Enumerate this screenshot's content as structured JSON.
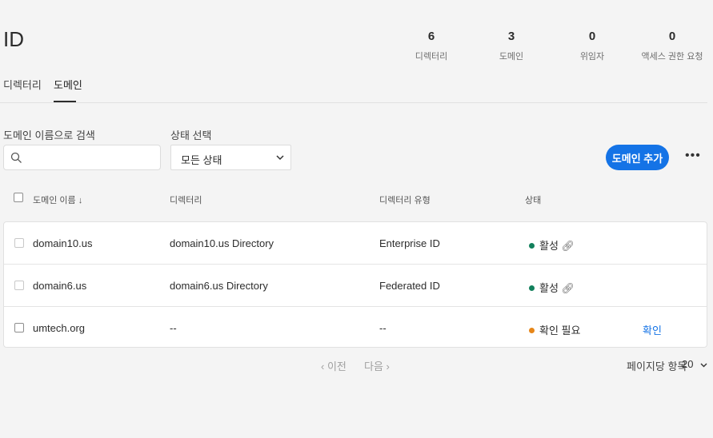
{
  "header": {
    "title": "ID",
    "stats": [
      {
        "value": "6",
        "label": "디렉터리"
      },
      {
        "value": "3",
        "label": "도메인"
      },
      {
        "value": "0",
        "label": "위임자"
      },
      {
        "value": "0",
        "label": "액세스 권한 요청"
      }
    ]
  },
  "tabs": [
    {
      "label": "디렉터리"
    },
    {
      "label": "도메인"
    }
  ],
  "filters": {
    "search_label": "도메인 이름으로 검색",
    "search_placeholder": "",
    "status_label": "상태 선택",
    "status_value": "모든 상태"
  },
  "actions": {
    "add_domain": "도메인 추가",
    "more": "•••"
  },
  "table": {
    "columns": [
      "도메인 이름",
      "디렉터리",
      "디렉터리 유형",
      "상태"
    ],
    "rows": [
      {
        "domain": "domain10.us",
        "directory": "domain10.us Directory",
        "type": "Enterprise ID",
        "status": "활성",
        "status_color": "#12805c",
        "action": ""
      },
      {
        "domain": "domain6.us",
        "directory": "domain6.us Directory",
        "type": "Federated ID",
        "status": "활성",
        "status_color": "#12805c",
        "action": ""
      },
      {
        "domain": "umtech.org",
        "directory": "--",
        "type": "--",
        "status": "확인 필요",
        "status_color": "#e68619",
        "action": "확인"
      }
    ]
  },
  "pagination": {
    "prev": "이전",
    "next": "다음",
    "per_page_label": "페이지당 항목",
    "per_page_value": "20"
  }
}
